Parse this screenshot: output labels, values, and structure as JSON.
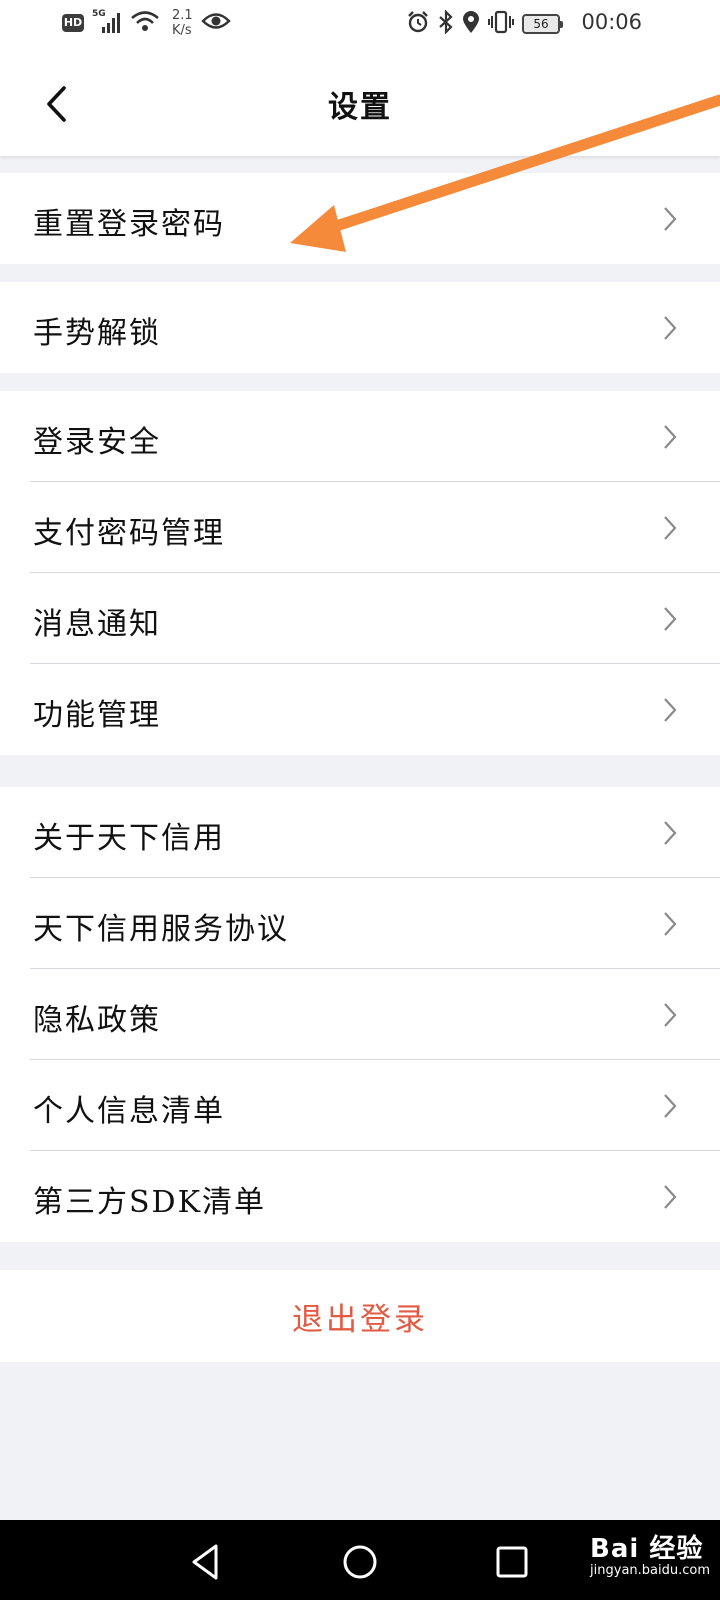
{
  "status_bar": {
    "hd_badge": "HD",
    "network": "5G",
    "speed_value": "2.1",
    "speed_unit": "K/s",
    "battery_level": "56",
    "time": "00:06",
    "left_icons": [
      "signal-icon",
      "wifi-icon",
      "eye-icon"
    ],
    "right_icons": [
      "alarm-icon",
      "bluetooth-icon",
      "location-icon",
      "vibrate-icon"
    ]
  },
  "header": {
    "title": "设置",
    "back_icon": "chevron-left-icon"
  },
  "groups": [
    {
      "items": [
        {
          "label": "重置登录密码"
        }
      ]
    },
    {
      "items": [
        {
          "label": "手势解锁"
        }
      ]
    },
    {
      "items": [
        {
          "label": "登录安全"
        },
        {
          "label": "支付密码管理"
        },
        {
          "label": "消息通知"
        },
        {
          "label": "功能管理"
        }
      ]
    },
    {
      "items": [
        {
          "label": "关于天下信用"
        },
        {
          "label": "天下信用服务协议"
        },
        {
          "label": "隐私政策"
        },
        {
          "label": "个人信息清单"
        },
        {
          "label": "第三方SDK清单"
        }
      ]
    }
  ],
  "logout": {
    "label": "退出登录",
    "color": "#e35a43"
  },
  "annotation": {
    "color": "#f58a3a",
    "icon": "arrow-annotation"
  },
  "nav_bar": {
    "icons": [
      "back-triangle-icon",
      "home-circle-icon",
      "recents-square-icon"
    ]
  },
  "watermark": {
    "main": "Bai 经验",
    "sub": "jingyan.baidu.com"
  }
}
